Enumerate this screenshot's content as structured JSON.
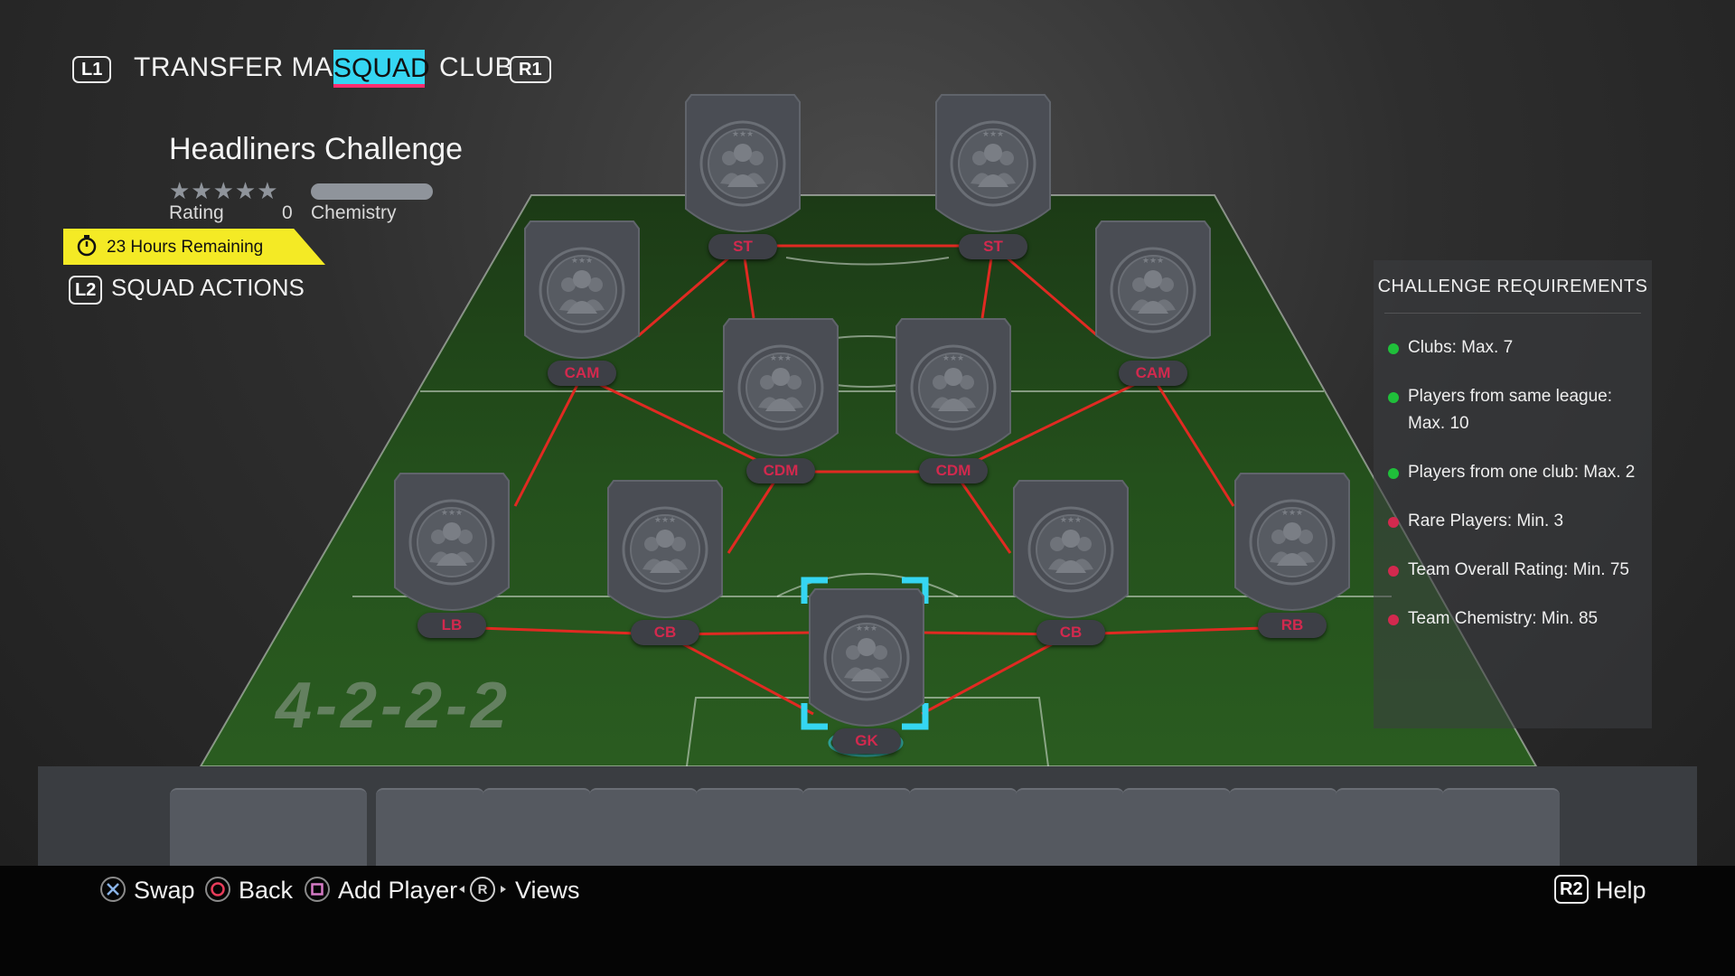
{
  "nav": {
    "left_bumper": "L1",
    "right_bumper": "R1",
    "items": [
      "TRANSFER MARKET",
      "SQUAD",
      "CLUB"
    ],
    "active": "SQUAD"
  },
  "challenge": {
    "title": "Headliners Challenge",
    "stars": "★★★★★",
    "rating_label": "Rating",
    "rating_value": "0",
    "chemistry_label": "Chemistry",
    "timer": "23 Hours Remaining"
  },
  "squad_actions": {
    "button": "L2",
    "label": "SQUAD ACTIONS"
  },
  "formation": "4-2-2-2",
  "positions": {
    "st_left": "ST",
    "st_right": "ST",
    "cam_left": "CAM",
    "cam_right": "CAM",
    "cdm_left": "CDM",
    "cdm_right": "CDM",
    "lb": "LB",
    "cb_left": "CB",
    "cb_right": "CB",
    "rb": "RB",
    "gk": "GK"
  },
  "requirements": {
    "title": "CHALLENGE REQUIREMENTS",
    "items": [
      {
        "text": "Clubs: Max. 7",
        "status": "met"
      },
      {
        "text": "Players from same league: Max. 10",
        "status": "met"
      },
      {
        "text": "Players from one club: Max. 2",
        "status": "met"
      },
      {
        "text": "Rare Players: Min. 3",
        "status": "unmet"
      },
      {
        "text": "Team Overall Rating: Min. 75",
        "status": "unmet"
      },
      {
        "text": "Team Chemistry: Min. 85",
        "status": "unmet"
      }
    ]
  },
  "footer": {
    "swap": "Swap",
    "back": "Back",
    "add_player": "Add Player",
    "views": "Views",
    "help_button": "R2",
    "help": "Help",
    "r_stick": "R"
  },
  "colors": {
    "accent_cyan": "#35d6f2",
    "accent_pink": "#ff2d6f",
    "link_red": "#e02a22",
    "met_green": "#1fbf3a",
    "unmet_red": "#d2294e",
    "timer_yellow": "#f4ea25"
  }
}
